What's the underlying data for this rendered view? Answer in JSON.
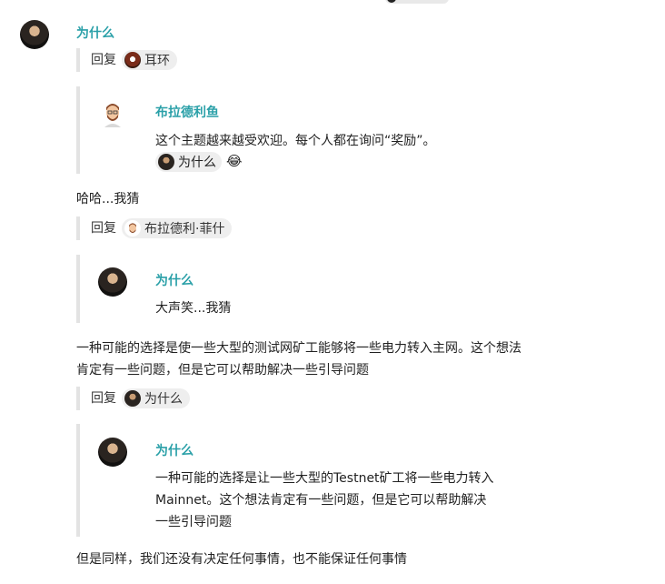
{
  "post1": {
    "author": "为什么",
    "reply_label": "回复",
    "reply_to": "耳环",
    "quote": {
      "author": "布拉德利鱼",
      "text": "这个主题越来越受欢迎。每个人都在询问“奖励”。",
      "reaction_user": "为什么",
      "reaction_emoji": "😂"
    },
    "body": "哈哈...我猜"
  },
  "post2": {
    "reply_label": "回复",
    "reply_to": "布拉德利·菲什",
    "quote": {
      "author": "为什么",
      "text": "大声笑...我猜"
    },
    "body_lines": [
      "一种可能的选择是使一些大型的测试网矿工能够将一些电力转入主网。这个想法",
      "肯定有一些问题，但是它可以帮助解决一些引导问题"
    ]
  },
  "post3": {
    "reply_label": "回复",
    "reply_to": "为什么",
    "quote": {
      "author": "为什么",
      "lines": [
        "一种可能的选择是让一些大型的Testnet矿工将一些电力转入",
        "Mainnet。这个想法肯定有一些问题，但是它可以帮助解决",
        "一些引导问题"
      ]
    },
    "body": "但是同样，我们还没有决定任何事情，也不能保证任何事情"
  }
}
